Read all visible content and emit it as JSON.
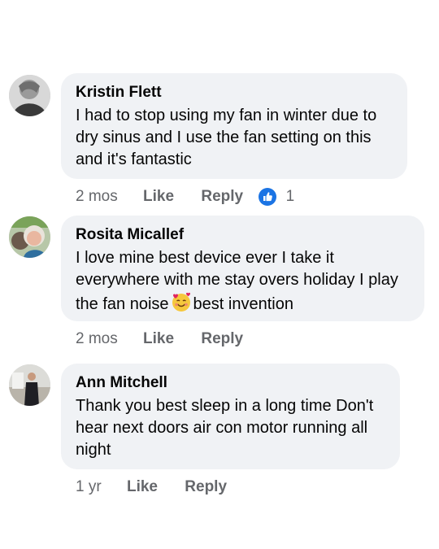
{
  "comments": [
    {
      "author": "Kristin Flett",
      "text": "I had to stop using my fan in winter due to dry sinus and I use the fan setting on this and it's fantastic",
      "time": "2 mos",
      "like_label": "Like",
      "reply_label": "Reply",
      "reaction_icon": "thumbs-up-icon",
      "reaction_count": "1"
    },
    {
      "author": "Rosita Micallef",
      "text_before_emoji": "I love mine best device ever I take it everywhere with me stay overs holiday I play the fan noise",
      "emoji": "smiling-face-with-hearts",
      "text_after_emoji": "best invention",
      "time": "2 mos",
      "like_label": "Like",
      "reply_label": "Reply"
    },
    {
      "author": "Ann Mitchell",
      "text": "Thank you best sleep in a long time Don't hear next doors air con motor running all night",
      "time": "1 yr",
      "like_label": "Like",
      "reply_label": "Reply"
    }
  ],
  "colors": {
    "bubble_bg": "#f0f2f5",
    "meta_text": "#65676b",
    "like_blue": "#1b74e4"
  }
}
